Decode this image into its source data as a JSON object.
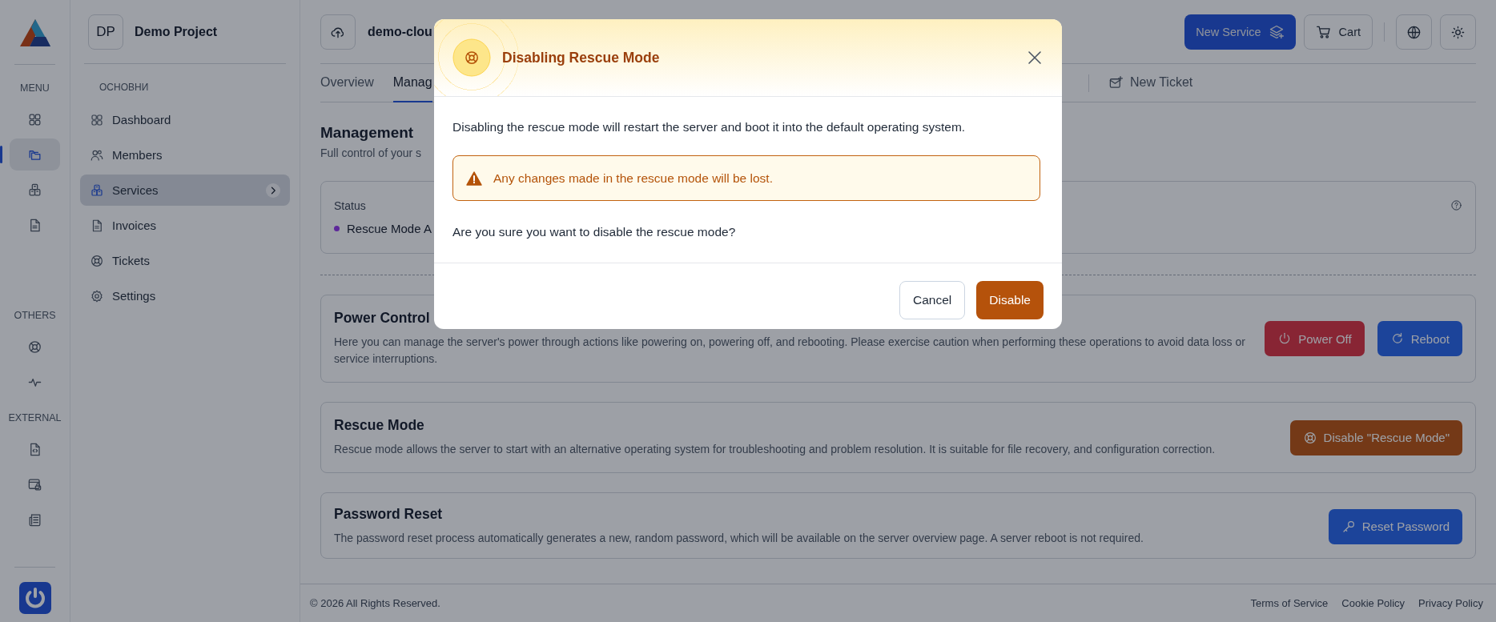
{
  "rail": {
    "sections": [
      {
        "label": "MENU",
        "items": [
          {
            "kind": "grid",
            "selected": false
          },
          {
            "kind": "folders",
            "selected": true
          },
          {
            "kind": "boxes",
            "selected": false
          },
          {
            "kind": "invoice",
            "selected": false
          }
        ]
      },
      {
        "label": "OTHERS",
        "items": [
          {
            "kind": "lifebuoy",
            "selected": false
          },
          {
            "kind": "pulse",
            "selected": false
          }
        ]
      },
      {
        "label": "EXTERNAL",
        "items": [
          {
            "kind": "code-file",
            "selected": false
          },
          {
            "kind": "browser-lock",
            "selected": false
          },
          {
            "kind": "newspaper",
            "selected": false
          }
        ]
      }
    ]
  },
  "project": {
    "initials": "DP",
    "name": "Demo Project"
  },
  "nav": {
    "heading": "ОСНОВНИ",
    "items": [
      {
        "kind": "grid",
        "label": "Dashboard",
        "selected": false
      },
      {
        "kind": "users",
        "label": "Members",
        "selected": false
      },
      {
        "kind": "boxes",
        "label": "Services",
        "selected": true
      },
      {
        "kind": "invoice",
        "label": "Invoices",
        "selected": false
      },
      {
        "kind": "lifebuoy",
        "label": "Tickets",
        "selected": false
      },
      {
        "kind": "gear",
        "label": "Settings",
        "selected": false
      }
    ]
  },
  "topbar": {
    "server_name": "demo-clou",
    "actions": [
      {
        "kind": "new-service",
        "label": "New Service"
      },
      {
        "kind": "cart",
        "label": "Cart"
      },
      {
        "kind": "language"
      },
      {
        "kind": "theme"
      }
    ]
  },
  "tabs": [
    {
      "kind": "tab",
      "label": "Overview",
      "selected": false
    },
    {
      "kind": "tab",
      "label": "Manag",
      "selected": true
    },
    {
      "kind": "action",
      "label": "New Ticket",
      "selected": false
    }
  ],
  "management": {
    "title": "Management",
    "subtitle": "Full control of your s"
  },
  "status": {
    "label": "Status",
    "value": "Rescue Mode A"
  },
  "sections": [
    {
      "title": "Power Control",
      "description": "Here you can manage the server's power through actions like powering on, powering off, and rebooting. Please exercise caution when performing these operations to avoid data loss or service interruptions.",
      "buttons": [
        {
          "kind": "power-off",
          "label": "Power Off"
        },
        {
          "kind": "reboot",
          "label": "Reboot"
        }
      ]
    },
    {
      "title": "Rescue Mode",
      "description": "Rescue mode allows the server to start with an alternative operating system for troubleshooting and problem resolution. It is suitable for file recovery, and configuration correction.",
      "buttons": [
        {
          "kind": "rescue",
          "label": "Disable \"Rescue Mode\""
        }
      ]
    },
    {
      "title": "Password Reset",
      "description": "The password reset process automatically generates a new, random password, which will be available on the server overview page. A server reboot is not required.",
      "buttons": [
        {
          "kind": "reset-password",
          "label": "Reset Password"
        }
      ]
    }
  ],
  "footer": {
    "copyright": "© 2026 All Rights Reserved.",
    "links": [
      "Terms of Service",
      "Cookie Policy",
      "Privacy Policy"
    ]
  },
  "dialog": {
    "title": "Disabling Rescue Mode",
    "message": "Disabling the rescue mode will restart the server and boot it into the default operating system.",
    "warning": "Any changes made in the rescue mode will be lost.",
    "question": "Are you sure you want to disable the rescue mode?",
    "buttons": [
      {
        "kind": "secondary",
        "label": "Cancel"
      },
      {
        "kind": "warning",
        "label": "Disable"
      }
    ]
  }
}
